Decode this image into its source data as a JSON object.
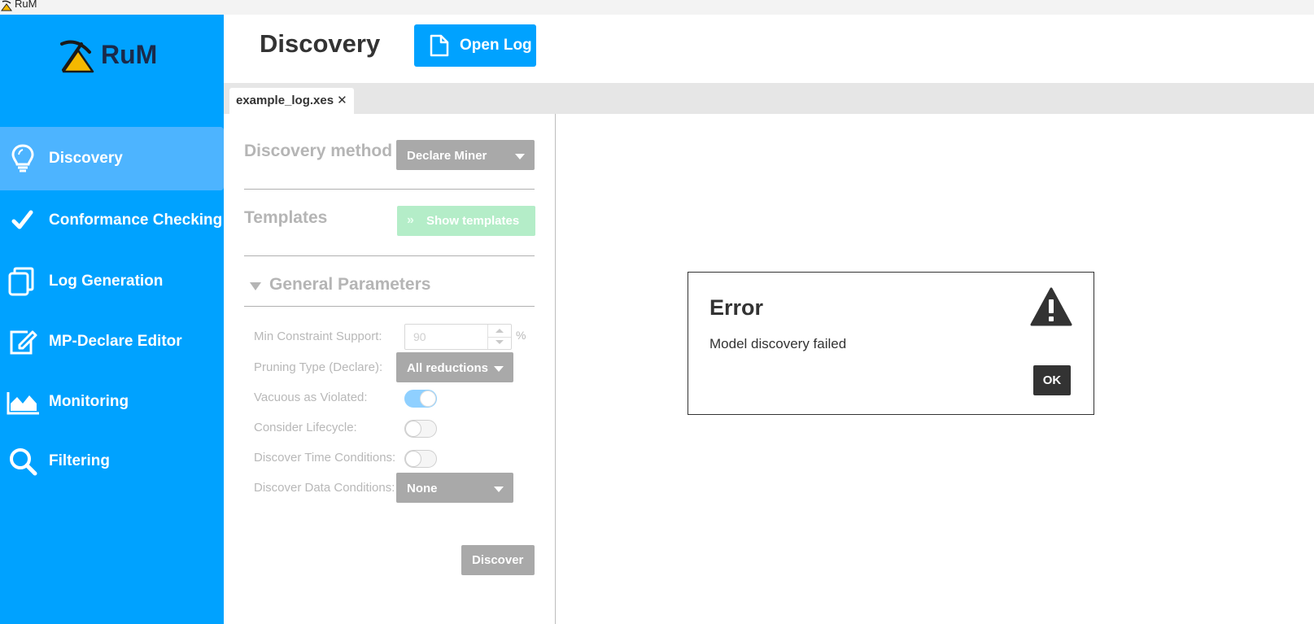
{
  "window": {
    "title": "RuM"
  },
  "app": {
    "name": "RuM"
  },
  "sidebar": {
    "items": [
      {
        "label": "Discovery",
        "icon": "lightbulb-icon",
        "active": true
      },
      {
        "label": "Conformance Checking",
        "icon": "check-icon",
        "active": false
      },
      {
        "label": "Log Generation",
        "icon": "stacked-pages-icon",
        "active": false
      },
      {
        "label": "MP-Declare Editor",
        "icon": "edit-icon",
        "active": false
      },
      {
        "label": "Monitoring",
        "icon": "area-chart-icon",
        "active": false
      },
      {
        "label": "Filtering",
        "icon": "search-icon",
        "active": false
      }
    ]
  },
  "header": {
    "title": "Discovery",
    "open_log_label": "Open Log"
  },
  "tabs": [
    {
      "label": "example_log.xes",
      "close": "✕"
    }
  ],
  "form": {
    "discovery_method_label": "Discovery method",
    "discovery_method_value": "Declare Miner",
    "templates_label": "Templates",
    "show_templates_label": "Show templates",
    "general_parameters_title": "General Parameters",
    "min_constraint_support_label": "Min Constraint Support:",
    "min_constraint_support_value": "90",
    "min_constraint_support_unit": "%",
    "pruning_type_label": "Pruning Type (Declare):",
    "pruning_type_value": "All reductions",
    "vacuous_label": "Vacuous as Violated:",
    "vacuous_on": true,
    "lifecycle_label": "Consider Lifecycle:",
    "lifecycle_on": false,
    "time_conditions_label": "Discover Time Conditions:",
    "time_conditions_on": false,
    "data_conditions_label": "Discover Data Conditions:",
    "data_conditions_value": "None",
    "discover_button": "Discover"
  },
  "dialog": {
    "title": "Error",
    "message": "Model discovery failed",
    "ok_label": "OK",
    "icon": "warning-icon"
  },
  "colors": {
    "sidebar_bg": "#00a2ff",
    "sidebar_active": "#4db4ff",
    "accent": "#00a2ff",
    "disabled_button": "#a9a9a9",
    "show_templates_bg": "#b4edc8",
    "dialog_button": "#333333"
  }
}
